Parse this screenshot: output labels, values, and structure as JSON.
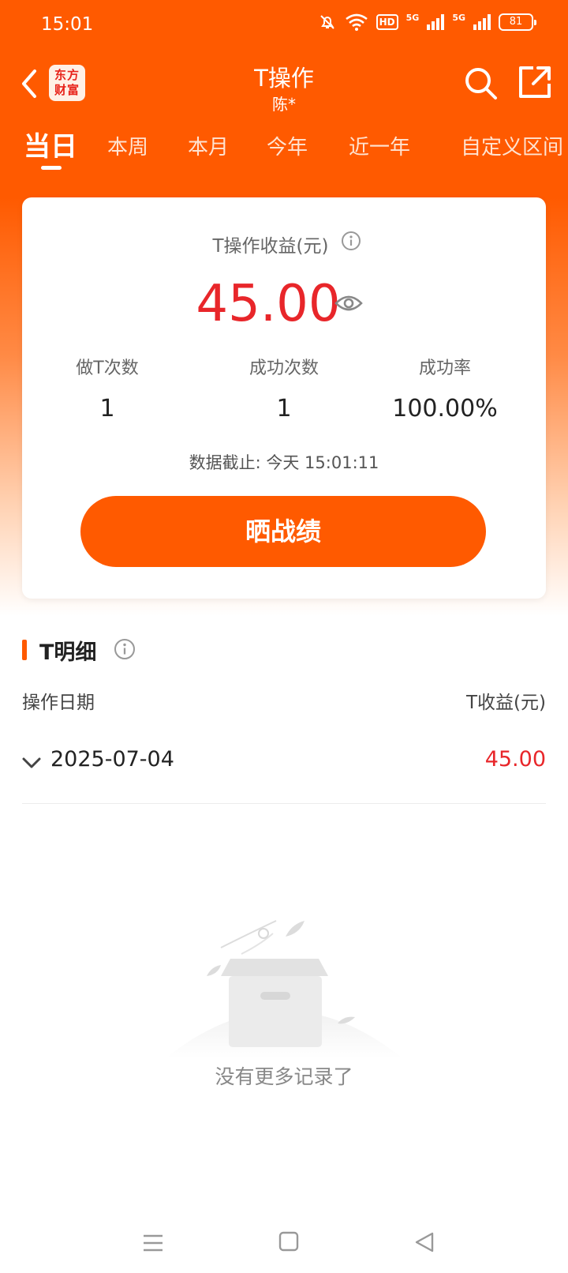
{
  "status_bar": {
    "time": "15:01",
    "battery": "81",
    "hd_badge": "HD",
    "net1": "5G",
    "net2": "5G"
  },
  "header": {
    "title": "T操作",
    "subtitle": "陈*",
    "logo_line1": "东方",
    "logo_line2": "财富"
  },
  "tabs": [
    {
      "label": "当日",
      "active": true
    },
    {
      "label": "本周"
    },
    {
      "label": "本月"
    },
    {
      "label": "今年"
    },
    {
      "label": "近一年"
    },
    {
      "label": "自定义区间"
    }
  ],
  "summary": {
    "label": "T操作收益(元)",
    "profit": "45.00",
    "stats": [
      {
        "label": "做T次数",
        "value": "1"
      },
      {
        "label": "成功次数",
        "value": "1"
      },
      {
        "label": "成功率",
        "value": "100.00%"
      }
    ],
    "data_time": "数据截止: 今天 15:01:11",
    "button_label": "晒战绩"
  },
  "detail": {
    "title": "T明细",
    "col_date": "操作日期",
    "col_profit": "T收益(元)",
    "rows": [
      {
        "date": "2025-07-04",
        "profit": "45.00"
      }
    ],
    "empty_text": "没有更多记录了"
  },
  "colors": {
    "brand": "#ff5a00",
    "profit_red": "#e8262a"
  }
}
